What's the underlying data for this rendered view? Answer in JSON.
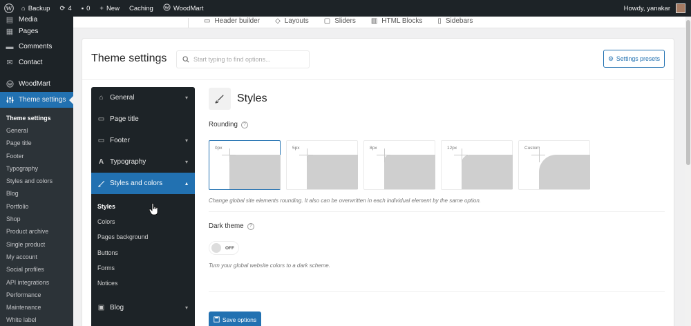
{
  "adminbar": {
    "site": "Backup",
    "updates": "4",
    "comments": "0",
    "new": "New",
    "caching": "Caching",
    "woodmart": "WoodMart",
    "howdy": "Howdy, yanakar"
  },
  "sidebar": {
    "items": [
      {
        "label": "Media",
        "icon": "media-icon"
      },
      {
        "label": "Pages",
        "icon": "pages-icon"
      },
      {
        "label": "Comments",
        "icon": "comments-icon"
      },
      {
        "label": "Contact",
        "icon": "mail-icon"
      },
      {
        "label": "WoodMart",
        "icon": "woodmart-icon"
      },
      {
        "label": "Theme settings",
        "icon": "sliders-icon"
      }
    ],
    "submenu": [
      "Theme settings",
      "General",
      "Page title",
      "Footer",
      "Typography",
      "Styles and colors",
      "Blog",
      "Portfolio",
      "Shop",
      "Product archive",
      "Single product",
      "My account",
      "Social profiles",
      "API integrations",
      "Performance",
      "Maintenance",
      "White label"
    ]
  },
  "topbar": {
    "items": [
      "Header builder",
      "Layouts",
      "Sliders",
      "HTML Blocks",
      "Sidebars"
    ]
  },
  "header": {
    "title": "Theme settings",
    "search_placeholder": "Start typing to find options...",
    "presets_label": "Settings presets"
  },
  "secnav": {
    "items": [
      {
        "label": "General",
        "icon": "home-icon",
        "has_children": true
      },
      {
        "label": "Page title",
        "icon": "page-title-icon",
        "has_children": false
      },
      {
        "label": "Footer",
        "icon": "footer-icon",
        "has_children": true
      },
      {
        "label": "Typography",
        "icon": "typography-icon",
        "has_children": true
      },
      {
        "label": "Styles and colors",
        "icon": "brush-icon",
        "has_children": true,
        "open": true
      }
    ],
    "subitems": [
      "Styles",
      "Colors",
      "Pages background",
      "Buttons",
      "Forms",
      "Notices"
    ],
    "after": [
      {
        "label": "Blog",
        "icon": "blog-icon",
        "has_children": true
      }
    ]
  },
  "content": {
    "section_title": "Styles",
    "rounding_label": "Rounding",
    "rounding_options": [
      {
        "label": "0px",
        "radius": 0
      },
      {
        "label": "5px",
        "radius": 5
      },
      {
        "label": "8px",
        "radius": 8
      },
      {
        "label": "12px",
        "radius": 12
      },
      {
        "label": "Custom",
        "radius": 25
      }
    ],
    "selected_rounding": "0px",
    "rounding_desc": "Change global site elements rounding. It also can be overwritten in each individual element by the same option.",
    "dark_label": "Dark theme",
    "dark_state": "OFF",
    "dark_desc": "Turn your global website colors to a dark scheme.",
    "save_label": "Save options"
  },
  "colors": {
    "accent": "#2271b1",
    "admin_dark": "#1d2327"
  }
}
